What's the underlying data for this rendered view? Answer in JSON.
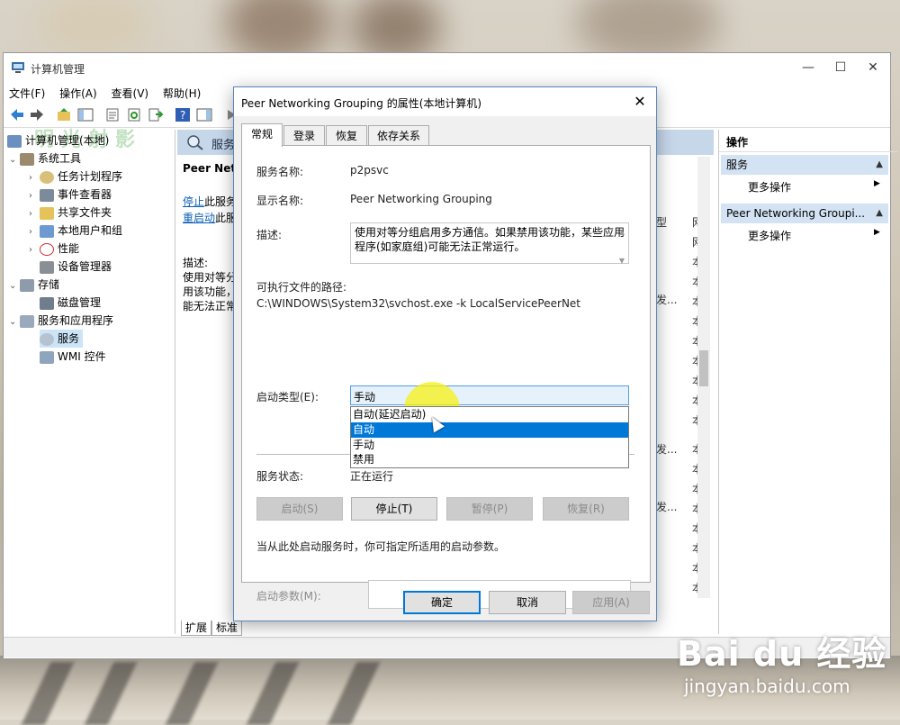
{
  "window": {
    "title": "计算机管理",
    "min": "—",
    "max": "☐",
    "close": "✕",
    "menu": [
      "文件(F)",
      "操作(A)",
      "查看(V)",
      "帮助(H)"
    ]
  },
  "tree": {
    "root": "计算机管理(本地)",
    "system_tools": "系统工具",
    "task_scheduler": "任务计划程序",
    "event_viewer": "事件查看器",
    "shared_folders": "共享文件夹",
    "local_users": "本地用户和组",
    "performance": "性能",
    "device_manager": "设备管理器",
    "storage": "存储",
    "disk_management": "磁盘管理",
    "services_apps": "服务和应用程序",
    "services": "服务",
    "wmi": "WMI 控件"
  },
  "center": {
    "header": "服务",
    "service_name": "Peer Netw",
    "stop_link": "停止",
    "stop_rest": "此服务",
    "restart_link": "重启动",
    "restart_rest": "此服",
    "desc_label": "描述:",
    "desc_lines": [
      "使用对等分",
      "用该功能，",
      "能无法正常"
    ],
    "col_header_type": "型",
    "col_chars": [
      "网",
      "网",
      "本",
      "本",
      "本",
      "本",
      "本",
      "本",
      "本",
      "本",
      "本",
      "本",
      "本",
      "本",
      "本",
      "本",
      "本",
      "本",
      "本",
      "本",
      "本",
      "本"
    ],
    "col_type_rows": [
      "发...",
      "发...",
      "发..."
    ],
    "tabs": [
      "扩展",
      "标准"
    ]
  },
  "actions": {
    "header": "操作",
    "section1": "服务",
    "more1": "更多操作",
    "section2": "Peer Networking Groupi...",
    "more2": "更多操作"
  },
  "dialog": {
    "title": "Peer Networking Grouping 的属性(本地计算机)",
    "tabs": [
      "常规",
      "登录",
      "恢复",
      "依存关系"
    ],
    "service_name_label": "服务名称:",
    "service_name_value": "p2psvc",
    "display_name_label": "显示名称:",
    "display_name_value": "Peer Networking Grouping",
    "description_label": "描述:",
    "description_value": "使用对等分组启用多方通信。如果禁用该功能，某些应用程序(如家庭组)可能无法正常运行。",
    "path_label": "可执行文件的路径:",
    "path_value": "C:\\WINDOWS\\System32\\svchost.exe -k LocalServicePeerNet",
    "startup_type_label": "启动类型(E):",
    "startup_type_value": "手动",
    "startup_options": [
      "自动(延迟启动)",
      "自动",
      "手动",
      "禁用"
    ],
    "status_label": "服务状态:",
    "status_value": "正在运行",
    "buttons": {
      "start": "启动(S)",
      "stop": "停止(T)",
      "pause": "暂停(P)",
      "resume": "恢复(R)"
    },
    "hint": "当从此处启动服务时，你可指定所适用的启动参数。",
    "param_label": "启动参数(M):",
    "ok": "确定",
    "cancel": "取消",
    "apply": "应用(A)"
  },
  "watermark": {
    "main": "Bai du 经验",
    "sub": "jingyan.baidu.com",
    "stamp": "明光射影"
  }
}
